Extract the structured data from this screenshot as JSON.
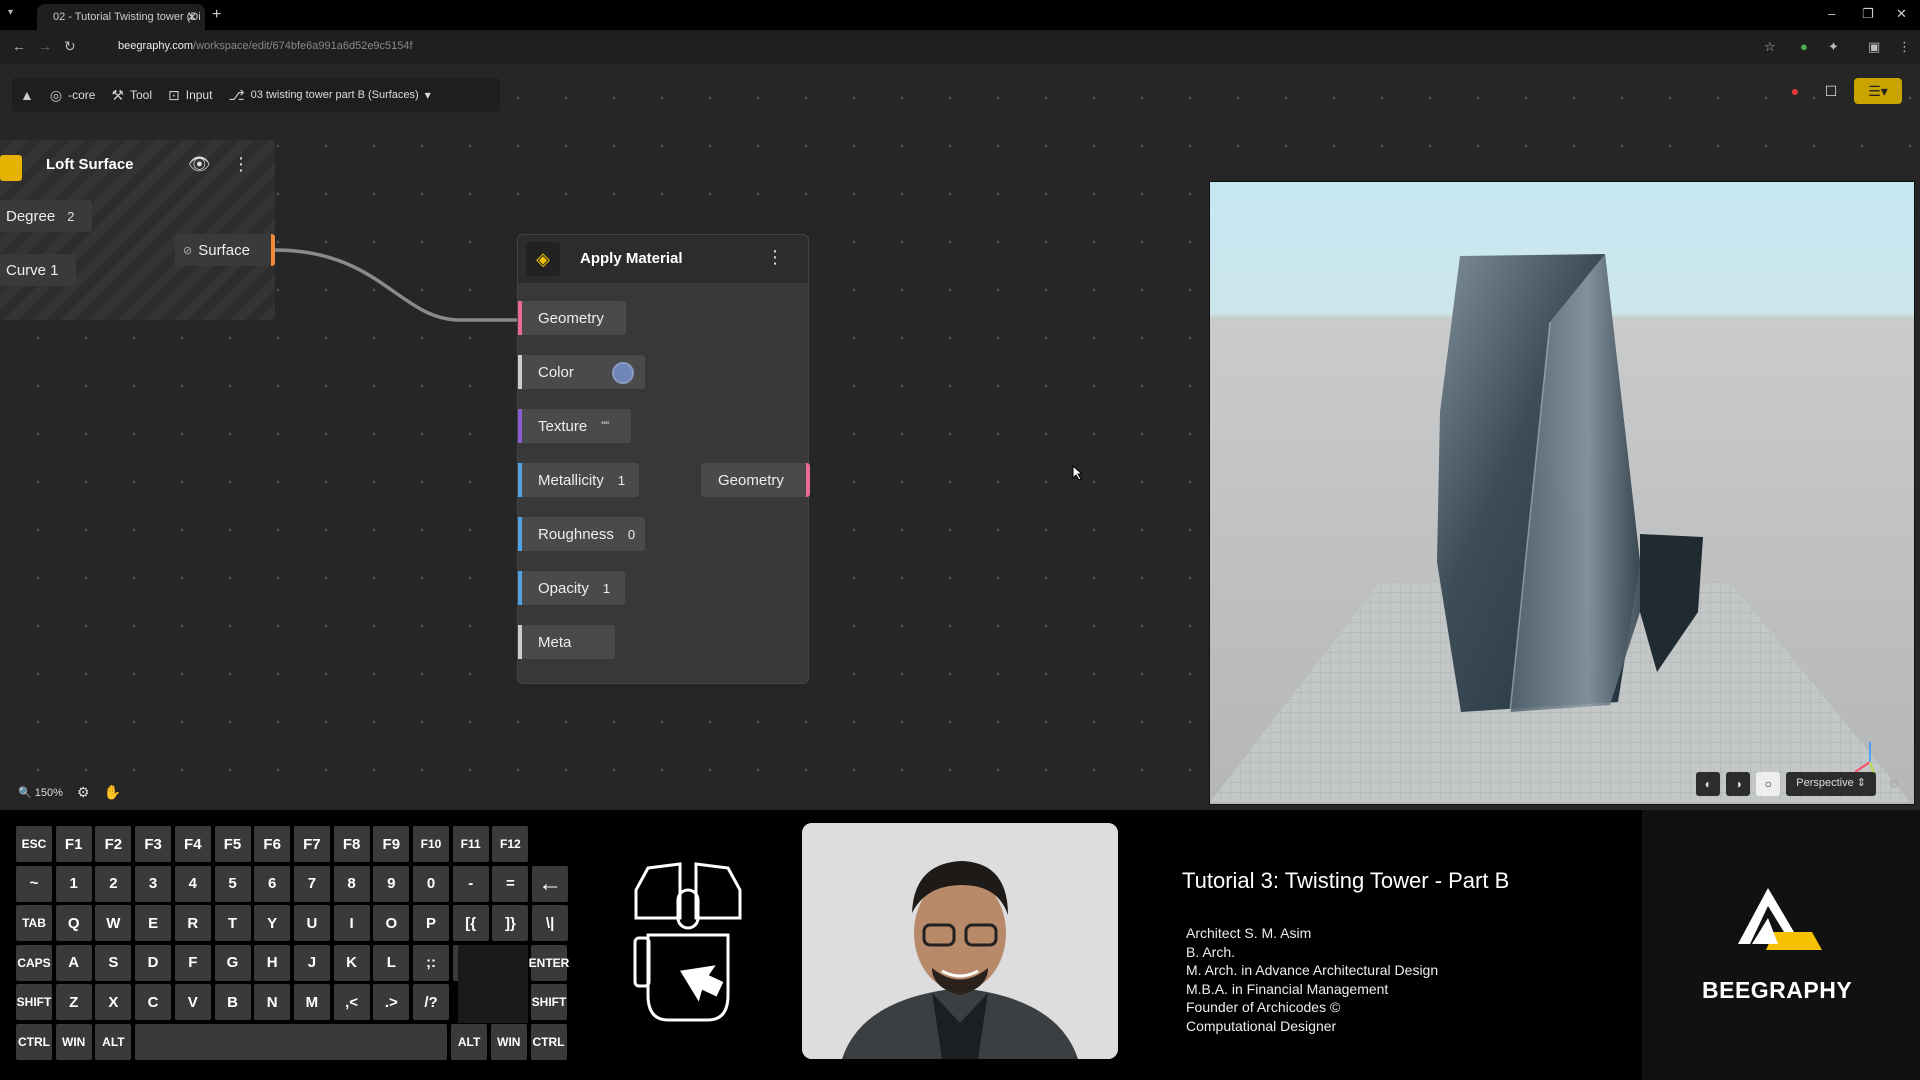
{
  "browser": {
    "tab_title": "02 - Tutorial Twisting tower (Di",
    "url_domain": "beegraphy.com",
    "url_path": "/workspace/edit/674bfe6a991a6d52e9c5154f"
  },
  "toolbar": {
    "core_label": "-core",
    "tool_label": "Tool",
    "input_label": "Input",
    "file_label": "03 twisting tower part B (Surfaces)"
  },
  "loft_node": {
    "title": "Loft Surface",
    "degree_label": "Degree",
    "degree_value": "2",
    "curve_label": "Curve 1",
    "output_label": "Surface"
  },
  "apply_node": {
    "title": "Apply Material",
    "inputs": [
      {
        "label": "Geometry",
        "value": ""
      },
      {
        "label": "Color",
        "value": ""
      },
      {
        "label": "Texture",
        "value": "\"\""
      },
      {
        "label": "Metallicity",
        "value": "1"
      },
      {
        "label": "Roughness",
        "value": "0"
      },
      {
        "label": "Opacity",
        "value": "1"
      },
      {
        "label": "Meta",
        "value": ""
      }
    ],
    "output_label": "Geometry",
    "color_swatch": "#6f86b8"
  },
  "viewport": {
    "camera_label": "Perspective"
  },
  "status": {
    "zoom": "150%"
  },
  "keyboard": {
    "row1": [
      "ESC",
      "F1",
      "F2",
      "F3",
      "F4",
      "F5",
      "F6",
      "F7",
      "F8",
      "F9",
      "F10",
      "F11",
      "F12"
    ],
    "row2": [
      "~",
      "1",
      "2",
      "3",
      "4",
      "5",
      "6",
      "7",
      "8",
      "9",
      "0",
      "-",
      "=",
      "←"
    ],
    "row3": [
      "TAB",
      "Q",
      "W",
      "E",
      "R",
      "T",
      "Y",
      "U",
      "I",
      "O",
      "P",
      "[{",
      "]}",
      "\\|"
    ],
    "row4": [
      "CAPS",
      "A",
      "S",
      "D",
      "F",
      "G",
      "H",
      "J",
      "K",
      "L",
      ";:",
      ",\"",
      "ENTER"
    ],
    "row5": [
      "SHIFT",
      "Z",
      "X",
      "C",
      "V",
      "B",
      "N",
      "M",
      ",<",
      ".>",
      "/?",
      "SHIFT"
    ],
    "row6": [
      "CTRL",
      "WIN",
      "ALT",
      "ALT",
      "WIN",
      "CTRL"
    ]
  },
  "overlay": {
    "course_title": "Tutorial 3: Twisting Tower - Part B",
    "bio": [
      "Architect S. M. Asim",
      "B. Arch.",
      "M. Arch. in Advance Architectural Design",
      "M.B.A. in Financial Management",
      "Founder of Archicodes ©",
      "Computational Designer"
    ],
    "brand": "BEEGRAPHY"
  },
  "colors": {
    "accent_orange": "#f08a3c",
    "wire": "#8a8a8a",
    "brand_yellow": "#f6c100"
  }
}
